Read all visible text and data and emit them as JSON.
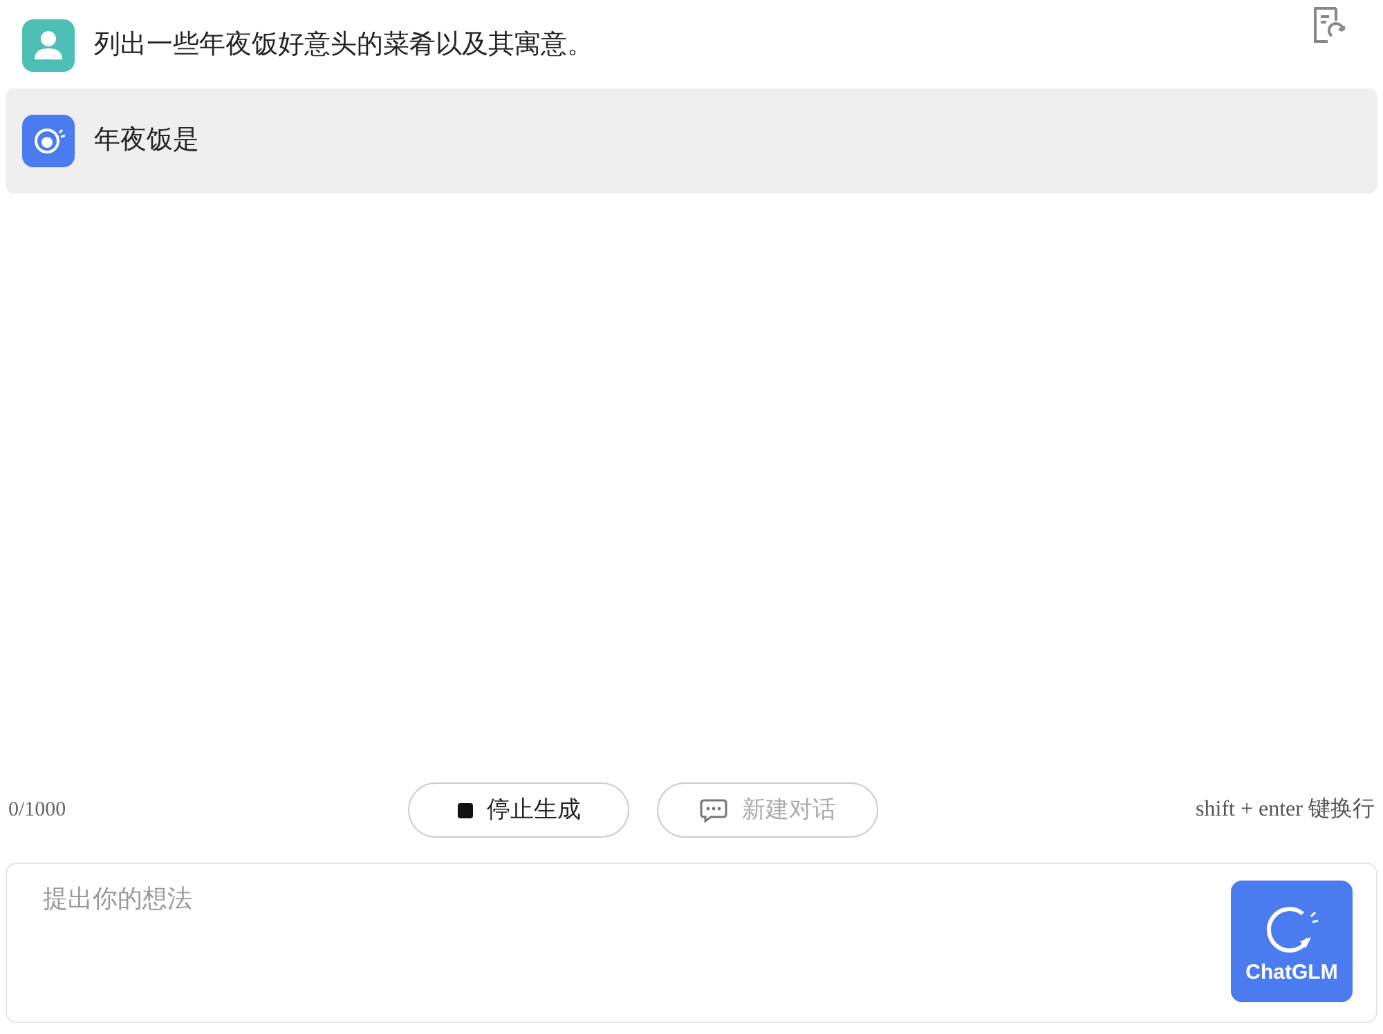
{
  "messages": [
    {
      "kind": "user",
      "text": "列出一些年夜饭好意头的菜肴以及其寓意。"
    },
    {
      "kind": "assistant",
      "text": "年夜饭是"
    }
  ],
  "counter": "0/1000",
  "actions": [
    {
      "kind": "stop",
      "label": "停止生成",
      "disabled": false
    },
    {
      "kind": "new_chat",
      "label": "新建对话",
      "disabled": true
    }
  ],
  "hint": "shift + enter 键换行",
  "input": {
    "placeholder": "提出你的想法"
  },
  "send_button": {
    "label": "ChatGLM"
  }
}
